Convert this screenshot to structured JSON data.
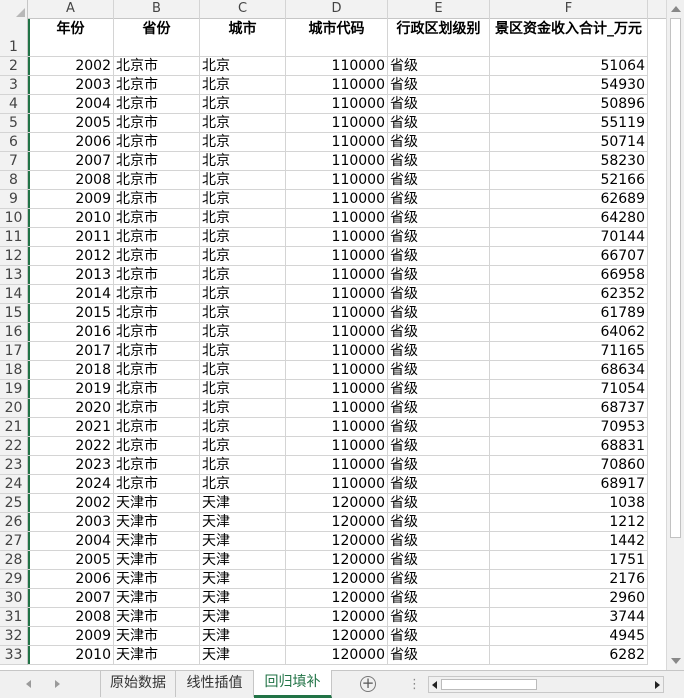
{
  "column_letters": [
    "A",
    "B",
    "C",
    "D",
    "E",
    "F"
  ],
  "headers": [
    "年份",
    "省份",
    "城市",
    "城市代码",
    "行政区划级别",
    "景区资金收入合计_万元"
  ],
  "row_numbers": [
    "1",
    "2",
    "3",
    "4",
    "5",
    "6",
    "7",
    "8",
    "9",
    "10",
    "11",
    "12",
    "13",
    "14",
    "15",
    "16",
    "17",
    "18",
    "19",
    "20",
    "21",
    "22",
    "23",
    "24",
    "25",
    "26",
    "27",
    "28",
    "29",
    "30",
    "31",
    "32",
    "33"
  ],
  "rows": [
    [
      "2002",
      "北京市",
      "北京",
      "110000",
      "省级",
      "51064"
    ],
    [
      "2003",
      "北京市",
      "北京",
      "110000",
      "省级",
      "54930"
    ],
    [
      "2004",
      "北京市",
      "北京",
      "110000",
      "省级",
      "50896"
    ],
    [
      "2005",
      "北京市",
      "北京",
      "110000",
      "省级",
      "55119"
    ],
    [
      "2006",
      "北京市",
      "北京",
      "110000",
      "省级",
      "50714"
    ],
    [
      "2007",
      "北京市",
      "北京",
      "110000",
      "省级",
      "58230"
    ],
    [
      "2008",
      "北京市",
      "北京",
      "110000",
      "省级",
      "52166"
    ],
    [
      "2009",
      "北京市",
      "北京",
      "110000",
      "省级",
      "62689"
    ],
    [
      "2010",
      "北京市",
      "北京",
      "110000",
      "省级",
      "64280"
    ],
    [
      "2011",
      "北京市",
      "北京",
      "110000",
      "省级",
      "70144"
    ],
    [
      "2012",
      "北京市",
      "北京",
      "110000",
      "省级",
      "66707"
    ],
    [
      "2013",
      "北京市",
      "北京",
      "110000",
      "省级",
      "66958"
    ],
    [
      "2014",
      "北京市",
      "北京",
      "110000",
      "省级",
      "62352"
    ],
    [
      "2015",
      "北京市",
      "北京",
      "110000",
      "省级",
      "61789"
    ],
    [
      "2016",
      "北京市",
      "北京",
      "110000",
      "省级",
      "64062"
    ],
    [
      "2017",
      "北京市",
      "北京",
      "110000",
      "省级",
      "71165"
    ],
    [
      "2018",
      "北京市",
      "北京",
      "110000",
      "省级",
      "68634"
    ],
    [
      "2019",
      "北京市",
      "北京",
      "110000",
      "省级",
      "71054"
    ],
    [
      "2020",
      "北京市",
      "北京",
      "110000",
      "省级",
      "68737"
    ],
    [
      "2021",
      "北京市",
      "北京",
      "110000",
      "省级",
      "70953"
    ],
    [
      "2022",
      "北京市",
      "北京",
      "110000",
      "省级",
      "68831"
    ],
    [
      "2023",
      "北京市",
      "北京",
      "110000",
      "省级",
      "70860"
    ],
    [
      "2024",
      "北京市",
      "北京",
      "110000",
      "省级",
      "68917"
    ],
    [
      "2002",
      "天津市",
      "天津",
      "120000",
      "省级",
      "1038"
    ],
    [
      "2003",
      "天津市",
      "天津",
      "120000",
      "省级",
      "1212"
    ],
    [
      "2004",
      "天津市",
      "天津",
      "120000",
      "省级",
      "1442"
    ],
    [
      "2005",
      "天津市",
      "天津",
      "120000",
      "省级",
      "1751"
    ],
    [
      "2006",
      "天津市",
      "天津",
      "120000",
      "省级",
      "2176"
    ],
    [
      "2007",
      "天津市",
      "天津",
      "120000",
      "省级",
      "2960"
    ],
    [
      "2008",
      "天津市",
      "天津",
      "120000",
      "省级",
      "3744"
    ],
    [
      "2009",
      "天津市",
      "天津",
      "120000",
      "省级",
      "4945"
    ],
    [
      "2010",
      "天津市",
      "天津",
      "120000",
      "省级",
      "6282"
    ]
  ],
  "sheet_tabs": [
    "原始数据",
    "线性插值",
    "回归填补"
  ],
  "active_tab": "回归填补",
  "add_sheet_label": "+",
  "accent_color": "#217346"
}
